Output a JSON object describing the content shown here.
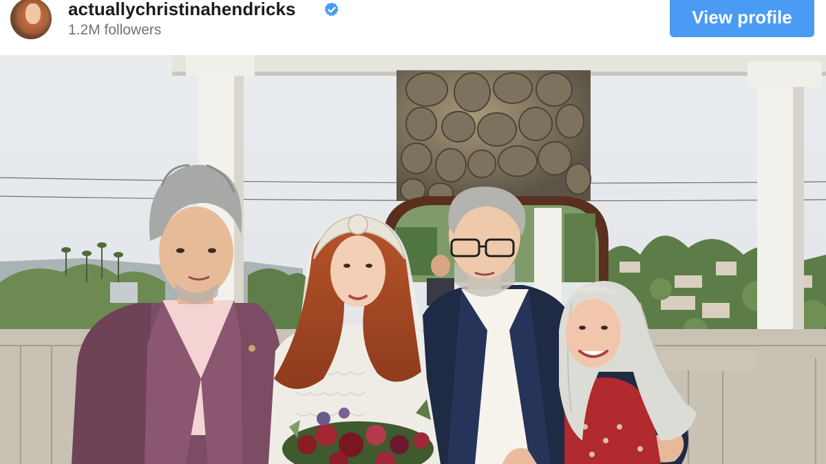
{
  "header": {
    "username": "actuallychristinahendricks",
    "verified": true,
    "followers": "1.2M followers",
    "view_profile_label": "View profile",
    "accent_color": "#4a9bf4"
  },
  "post": {
    "image_subject": "wedding-group-photo"
  }
}
